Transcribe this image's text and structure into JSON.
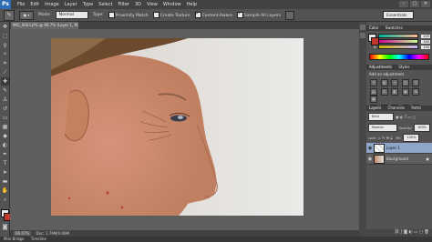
{
  "app": {
    "logo": "Ps"
  },
  "menu": [
    "File",
    "Edit",
    "Image",
    "Layer",
    "Type",
    "Select",
    "Filter",
    "3D",
    "View",
    "Window",
    "Help"
  ],
  "window_buttons": [
    "–",
    "□",
    "✕"
  ],
  "options": {
    "mode_label": "Mode:",
    "mode_value": "Normal",
    "type_label": "Type:",
    "proximity": "Proximity Match",
    "create_texture": "Create Texture",
    "content_aware": "Content-Aware",
    "sample_all": "Sample All Layers"
  },
  "workspace": "Essentials",
  "document": {
    "tab_title": "IMG_0663.JPG @ 66.7% (Layer 1, RGB/8#) *"
  },
  "status": {
    "zoom": "66.67%",
    "doc_info": "Doc: 1.79M/4.06M"
  },
  "bottom_tabs": [
    "Mini Bridge",
    "Timeline"
  ],
  "color_panel": {
    "tabs": [
      "Color",
      "Swatches"
    ],
    "sliders": [
      {
        "label": "R",
        "value": "205"
      },
      {
        "label": "G",
        "value": "180"
      },
      {
        "label": "B",
        "value": "150"
      }
    ]
  },
  "adjustments_panel": {
    "tabs": [
      "Adjustments",
      "Styles"
    ],
    "title": "Add an adjustment"
  },
  "layers_panel": {
    "tabs": [
      "Layers",
      "Channels",
      "Paths"
    ],
    "kind": "Kind",
    "blend": "Normal",
    "opacity_label": "Opacity:",
    "opacity_value": "100%",
    "lock_label": "Lock:",
    "fill_label": "Fill:",
    "fill_value": "100%",
    "layers": [
      {
        "name": "Layer 1"
      },
      {
        "name": "Background"
      }
    ]
  },
  "colors": {
    "ps_blue": "#2d6db3",
    "selected_layer": "#8fa6c9",
    "panel": "#535353"
  }
}
